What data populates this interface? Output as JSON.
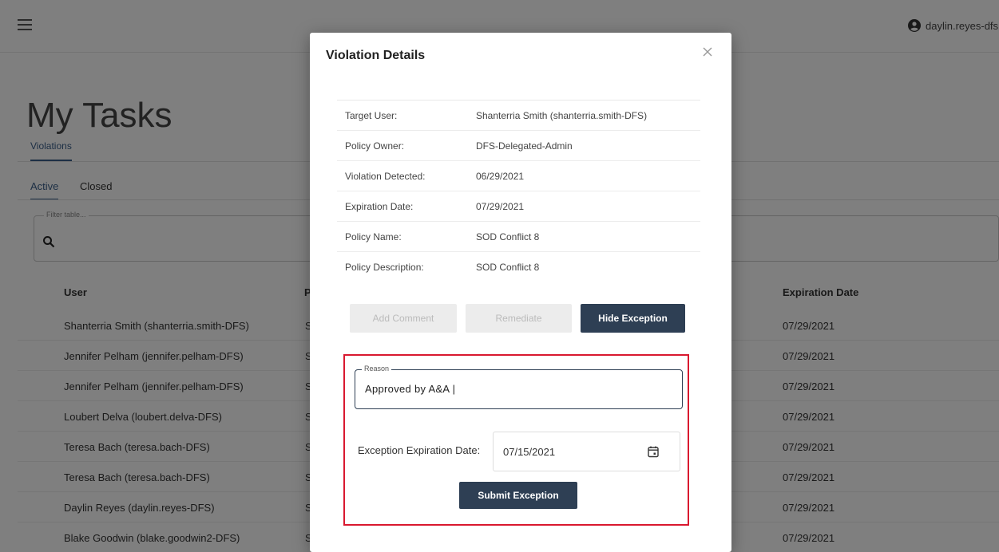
{
  "header": {
    "username": "daylin.reyes-dfs"
  },
  "page": {
    "title": "My Tasks",
    "tab_violations": "Violations",
    "subtab_active": "Active",
    "subtab_closed": "Closed",
    "filter_label": "Filter table..."
  },
  "table": {
    "col_user": "User",
    "col_stub": "P",
    "col_expiration": "Expiration Date",
    "rows": [
      {
        "user": "Shanterria Smith (shanterria.smith-DFS)",
        "expiration": "07/29/2021"
      },
      {
        "user": "Jennifer Pelham (jennifer.pelham-DFS)",
        "expiration": "07/29/2021"
      },
      {
        "user": "Jennifer Pelham (jennifer.pelham-DFS)",
        "expiration": "07/29/2021"
      },
      {
        "user": "Loubert Delva (loubert.delva-DFS)",
        "expiration": "07/29/2021"
      },
      {
        "user": "Teresa Bach (teresa.bach-DFS)",
        "expiration": "07/29/2021"
      },
      {
        "user": "Teresa Bach (teresa.bach-DFS)",
        "expiration": "07/29/2021"
      },
      {
        "user": "Daylin Reyes (daylin.reyes-DFS)",
        "expiration": "07/29/2021"
      },
      {
        "user": "Blake Goodwin (blake.goodwin2-DFS)",
        "expiration": "07/29/2021"
      }
    ],
    "stub_char": "S"
  },
  "modal": {
    "title": "Violation Details",
    "details": [
      {
        "label": "Target User:",
        "value": "Shanterria Smith (shanterria.smith-DFS)"
      },
      {
        "label": "Policy Owner:",
        "value": "DFS-Delegated-Admin"
      },
      {
        "label": "Violation Detected:",
        "value": "06/29/2021"
      },
      {
        "label": "Expiration Date:",
        "value": "07/29/2021"
      },
      {
        "label": "Policy Name:",
        "value": "SOD Conflict 8"
      },
      {
        "label": "Policy Description:",
        "value": "SOD Conflict 8"
      }
    ],
    "btn_add_comment": "Add Comment",
    "btn_remediate": "Remediate",
    "btn_hide_exception": "Hide Exception",
    "reason_label": "Reason",
    "reason_value": "Approved by A&A |",
    "exception_date_label": "Exception Expiration Date:",
    "exception_date_value": "07/15/2021",
    "btn_submit": "Submit Exception"
  },
  "colors": {
    "primary": "#2e3f54",
    "accent_tab": "#3b5f8a",
    "highlight": "#d9182f"
  }
}
